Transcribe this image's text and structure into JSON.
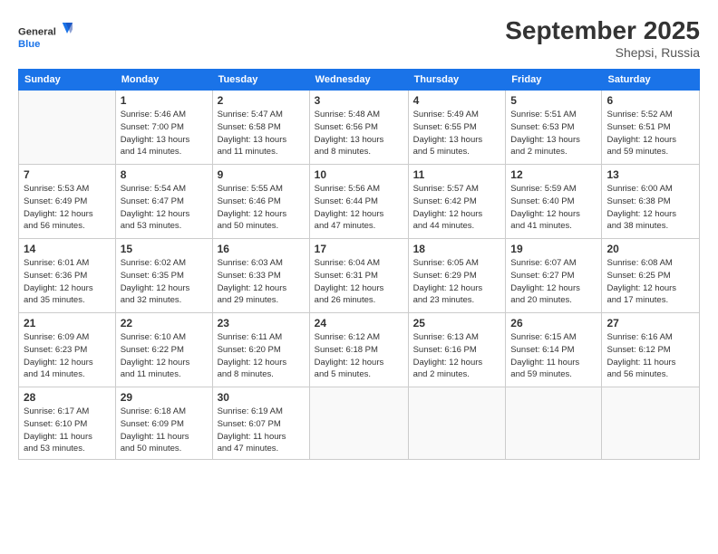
{
  "header": {
    "logo_general": "General",
    "logo_blue": "Blue",
    "month_title": "September 2025",
    "location": "Shepsi, Russia"
  },
  "days_of_week": [
    "Sunday",
    "Monday",
    "Tuesday",
    "Wednesday",
    "Thursday",
    "Friday",
    "Saturday"
  ],
  "weeks": [
    [
      {
        "day": "",
        "info": ""
      },
      {
        "day": "1",
        "info": "Sunrise: 5:46 AM\nSunset: 7:00 PM\nDaylight: 13 hours\nand 14 minutes."
      },
      {
        "day": "2",
        "info": "Sunrise: 5:47 AM\nSunset: 6:58 PM\nDaylight: 13 hours\nand 11 minutes."
      },
      {
        "day": "3",
        "info": "Sunrise: 5:48 AM\nSunset: 6:56 PM\nDaylight: 13 hours\nand 8 minutes."
      },
      {
        "day": "4",
        "info": "Sunrise: 5:49 AM\nSunset: 6:55 PM\nDaylight: 13 hours\nand 5 minutes."
      },
      {
        "day": "5",
        "info": "Sunrise: 5:51 AM\nSunset: 6:53 PM\nDaylight: 13 hours\nand 2 minutes."
      },
      {
        "day": "6",
        "info": "Sunrise: 5:52 AM\nSunset: 6:51 PM\nDaylight: 12 hours\nand 59 minutes."
      }
    ],
    [
      {
        "day": "7",
        "info": "Sunrise: 5:53 AM\nSunset: 6:49 PM\nDaylight: 12 hours\nand 56 minutes."
      },
      {
        "day": "8",
        "info": "Sunrise: 5:54 AM\nSunset: 6:47 PM\nDaylight: 12 hours\nand 53 minutes."
      },
      {
        "day": "9",
        "info": "Sunrise: 5:55 AM\nSunset: 6:46 PM\nDaylight: 12 hours\nand 50 minutes."
      },
      {
        "day": "10",
        "info": "Sunrise: 5:56 AM\nSunset: 6:44 PM\nDaylight: 12 hours\nand 47 minutes."
      },
      {
        "day": "11",
        "info": "Sunrise: 5:57 AM\nSunset: 6:42 PM\nDaylight: 12 hours\nand 44 minutes."
      },
      {
        "day": "12",
        "info": "Sunrise: 5:59 AM\nSunset: 6:40 PM\nDaylight: 12 hours\nand 41 minutes."
      },
      {
        "day": "13",
        "info": "Sunrise: 6:00 AM\nSunset: 6:38 PM\nDaylight: 12 hours\nand 38 minutes."
      }
    ],
    [
      {
        "day": "14",
        "info": "Sunrise: 6:01 AM\nSunset: 6:36 PM\nDaylight: 12 hours\nand 35 minutes."
      },
      {
        "day": "15",
        "info": "Sunrise: 6:02 AM\nSunset: 6:35 PM\nDaylight: 12 hours\nand 32 minutes."
      },
      {
        "day": "16",
        "info": "Sunrise: 6:03 AM\nSunset: 6:33 PM\nDaylight: 12 hours\nand 29 minutes."
      },
      {
        "day": "17",
        "info": "Sunrise: 6:04 AM\nSunset: 6:31 PM\nDaylight: 12 hours\nand 26 minutes."
      },
      {
        "day": "18",
        "info": "Sunrise: 6:05 AM\nSunset: 6:29 PM\nDaylight: 12 hours\nand 23 minutes."
      },
      {
        "day": "19",
        "info": "Sunrise: 6:07 AM\nSunset: 6:27 PM\nDaylight: 12 hours\nand 20 minutes."
      },
      {
        "day": "20",
        "info": "Sunrise: 6:08 AM\nSunset: 6:25 PM\nDaylight: 12 hours\nand 17 minutes."
      }
    ],
    [
      {
        "day": "21",
        "info": "Sunrise: 6:09 AM\nSunset: 6:23 PM\nDaylight: 12 hours\nand 14 minutes."
      },
      {
        "day": "22",
        "info": "Sunrise: 6:10 AM\nSunset: 6:22 PM\nDaylight: 12 hours\nand 11 minutes."
      },
      {
        "day": "23",
        "info": "Sunrise: 6:11 AM\nSunset: 6:20 PM\nDaylight: 12 hours\nand 8 minutes."
      },
      {
        "day": "24",
        "info": "Sunrise: 6:12 AM\nSunset: 6:18 PM\nDaylight: 12 hours\nand 5 minutes."
      },
      {
        "day": "25",
        "info": "Sunrise: 6:13 AM\nSunset: 6:16 PM\nDaylight: 12 hours\nand 2 minutes."
      },
      {
        "day": "26",
        "info": "Sunrise: 6:15 AM\nSunset: 6:14 PM\nDaylight: 11 hours\nand 59 minutes."
      },
      {
        "day": "27",
        "info": "Sunrise: 6:16 AM\nSunset: 6:12 PM\nDaylight: 11 hours\nand 56 minutes."
      }
    ],
    [
      {
        "day": "28",
        "info": "Sunrise: 6:17 AM\nSunset: 6:10 PM\nDaylight: 11 hours\nand 53 minutes."
      },
      {
        "day": "29",
        "info": "Sunrise: 6:18 AM\nSunset: 6:09 PM\nDaylight: 11 hours\nand 50 minutes."
      },
      {
        "day": "30",
        "info": "Sunrise: 6:19 AM\nSunset: 6:07 PM\nDaylight: 11 hours\nand 47 minutes."
      },
      {
        "day": "",
        "info": ""
      },
      {
        "day": "",
        "info": ""
      },
      {
        "day": "",
        "info": ""
      },
      {
        "day": "",
        "info": ""
      }
    ]
  ]
}
